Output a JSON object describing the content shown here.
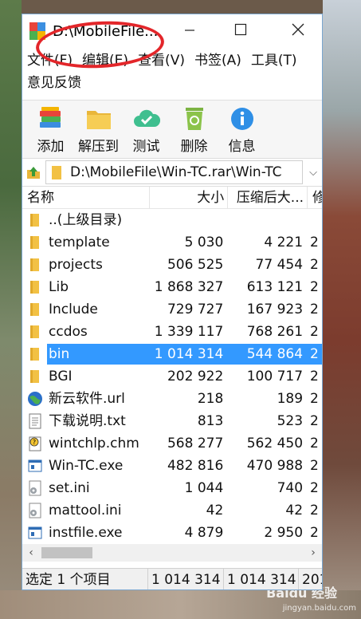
{
  "window": {
    "title": "D:\\MobileFile...",
    "minimize_icon": "minimize-icon",
    "maximize_icon": "maximize-icon",
    "close_icon": "close-icon"
  },
  "menu": [
    "文件(F)",
    "编辑(E)",
    "查看(V)",
    "书签(A)",
    "工具(T)",
    "意见反馈"
  ],
  "toolbar": [
    {
      "label": "添加",
      "icon": "books-add-icon"
    },
    {
      "label": "解压到",
      "icon": "folder-extract-icon"
    },
    {
      "label": "测试",
      "icon": "cloud-check-icon"
    },
    {
      "label": "删除",
      "icon": "recycle-bin-icon"
    },
    {
      "label": "信息",
      "icon": "info-icon"
    }
  ],
  "address": {
    "path": "D:\\MobileFile\\Win-TC.rar\\Win-TC"
  },
  "columns": {
    "name": "名称",
    "size": "大小",
    "packed": "压缩后大...",
    "modified": "修"
  },
  "files": [
    {
      "name": "..(上级目录)",
      "size": "",
      "packed": "",
      "mod": "",
      "icon": "folder-icon"
    },
    {
      "name": "template",
      "size": "5 030",
      "packed": "4 221",
      "mod": "2",
      "icon": "folder-icon"
    },
    {
      "name": "projects",
      "size": "506 525",
      "packed": "77 454",
      "mod": "2",
      "icon": "folder-icon"
    },
    {
      "name": "Lib",
      "size": "1 868 327",
      "packed": "613 121",
      "mod": "2",
      "icon": "folder-icon"
    },
    {
      "name": "Include",
      "size": "729 727",
      "packed": "167 923",
      "mod": "2",
      "icon": "folder-icon"
    },
    {
      "name": "ccdos",
      "size": "1 339 117",
      "packed": "768 261",
      "mod": "2",
      "icon": "folder-icon"
    },
    {
      "name": "bin",
      "size": "1 014 314",
      "packed": "544 864",
      "mod": "2",
      "icon": "folder-icon",
      "selected": true
    },
    {
      "name": "BGI",
      "size": "202 922",
      "packed": "100 717",
      "mod": "2",
      "icon": "folder-icon"
    },
    {
      "name": "新云软件.url",
      "size": "218",
      "packed": "189",
      "mod": "2",
      "icon": "globe-url-icon"
    },
    {
      "name": "下载说明.txt",
      "size": "813",
      "packed": "523",
      "mod": "2",
      "icon": "text-file-icon"
    },
    {
      "name": "wintchlp.chm",
      "size": "568 277",
      "packed": "562 450",
      "mod": "2",
      "icon": "help-file-icon"
    },
    {
      "name": "Win-TC.exe",
      "size": "482 816",
      "packed": "470 988",
      "mod": "2",
      "icon": "exe-file-icon"
    },
    {
      "name": "set.ini",
      "size": "1 044",
      "packed": "740",
      "mod": "2",
      "icon": "ini-file-icon"
    },
    {
      "name": "mattool.ini",
      "size": "42",
      "packed": "42",
      "mod": "2",
      "icon": "ini-file-icon"
    },
    {
      "name": "instfile.exe",
      "size": "4 879",
      "packed": "2 950",
      "mod": "2",
      "icon": "exe-file-icon"
    }
  ],
  "status": {
    "selection": "选定 1 个项目",
    "size": "1 014 314",
    "packed": "1 014 314",
    "date": "201"
  },
  "watermark": {
    "main": "Baidu 经验",
    "sub": "jingyan.baidu.com"
  },
  "colors": {
    "selection": "#3399ff",
    "annotation_circle": "#e3262a",
    "folder": "#f2c144"
  }
}
